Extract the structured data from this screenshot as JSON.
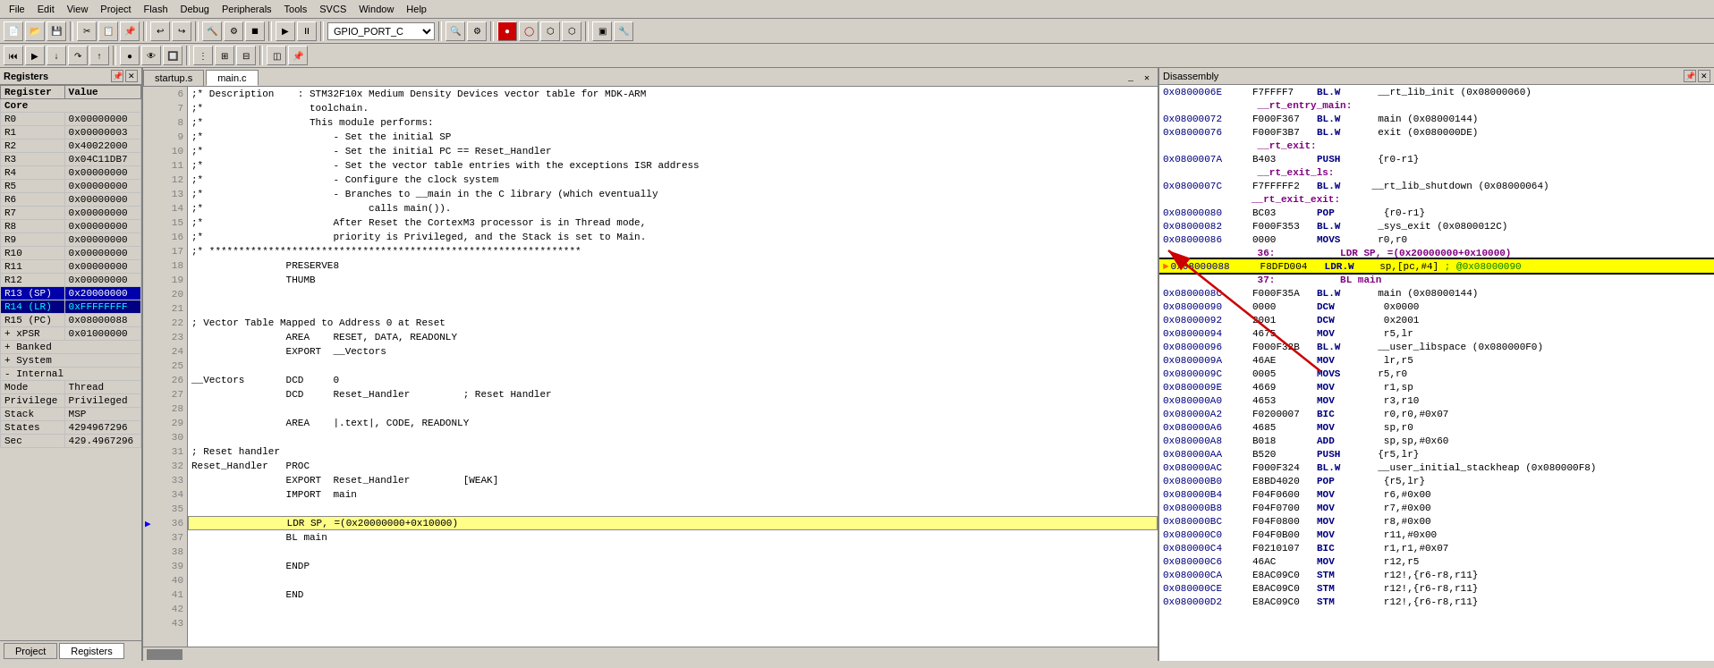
{
  "menubar": {
    "items": [
      "File",
      "Edit",
      "View",
      "Project",
      "Flash",
      "Debug",
      "Peripherals",
      "Tools",
      "SVCS",
      "Window",
      "Help"
    ]
  },
  "toolbar": {
    "dropdown_value": "GPIO_PORT_C"
  },
  "registers_panel": {
    "title": "Registers",
    "headers": [
      "Register",
      "Value"
    ],
    "core_label": "Core",
    "registers": [
      {
        "name": "R0",
        "value": "0x00000000"
      },
      {
        "name": "R1",
        "value": "0x00000003"
      },
      {
        "name": "R2",
        "value": "0x40022000"
      },
      {
        "name": "R3",
        "value": "0x04C11DB7"
      },
      {
        "name": "R4",
        "value": "0x00000000"
      },
      {
        "name": "R5",
        "value": "0x00000000"
      },
      {
        "name": "R6",
        "value": "0x00000000"
      },
      {
        "name": "R7",
        "value": "0x00000000"
      },
      {
        "name": "R8",
        "value": "0x00000000"
      },
      {
        "name": "R9",
        "value": "0x00000000"
      },
      {
        "name": "R10",
        "value": "0x00000000"
      },
      {
        "name": "R11",
        "value": "0x00000000"
      },
      {
        "name": "R12",
        "value": "0x00000000"
      },
      {
        "name": "R13 (SP)",
        "value": "0x20000000",
        "highlight": "sp"
      },
      {
        "name": "R14 (LR)",
        "value": "0xFFFFFFFF",
        "highlight": "pc"
      },
      {
        "name": "R15 (PC)",
        "value": "0x08000088"
      }
    ],
    "xpsr_label": "xPSR",
    "xpsr_value": "0x01000000",
    "banked_label": "Banked",
    "system_label": "System",
    "internal_label": "Internal",
    "internal_items": [
      {
        "label": "Mode",
        "value": "Thread"
      },
      {
        "label": "Privilege",
        "value": "Privileged"
      },
      {
        "label": "Stack",
        "value": "MSP"
      },
      {
        "label": "States",
        "value": "4294967296"
      },
      {
        "label": "Sec",
        "value": "429.4967296"
      }
    ]
  },
  "code_tabs": [
    {
      "label": "startup.s",
      "active": false
    },
    {
      "label": "main.c",
      "active": true
    }
  ],
  "code_lines": [
    {
      "num": 6,
      "text": ";* Description    : STM32F10x Medium Density Devices vector table for MDK-ARM"
    },
    {
      "num": 7,
      "text": ";*                  toolchain."
    },
    {
      "num": 8,
      "text": ";*                  This module performs:"
    },
    {
      "num": 9,
      "text": ";*                      - Set the initial SP"
    },
    {
      "num": 10,
      "text": ";*                      - Set the initial PC == Reset_Handler"
    },
    {
      "num": 11,
      "text": ";*                      - Set the vector table entries with the exceptions ISR address"
    },
    {
      "num": 12,
      "text": ";*                      - Configure the clock system"
    },
    {
      "num": 13,
      "text": ";*                      - Branches to __main in the C library (which eventually"
    },
    {
      "num": 14,
      "text": ";*                            calls main())."
    },
    {
      "num": 15,
      "text": ";*                      After Reset the CortexM3 processor is in Thread mode,"
    },
    {
      "num": 16,
      "text": ";*                      priority is Privileged, and the Stack is set to Main."
    },
    {
      "num": 17,
      "text": ";* ***************************************************************"
    },
    {
      "num": 18,
      "text": "                PRESERVE8"
    },
    {
      "num": 19,
      "text": "                THUMB"
    },
    {
      "num": 20,
      "text": ""
    },
    {
      "num": 21,
      "text": ""
    },
    {
      "num": 22,
      "text": "; Vector Table Mapped to Address 0 at Reset"
    },
    {
      "num": 23,
      "text": "                AREA    RESET, DATA, READONLY"
    },
    {
      "num": 24,
      "text": "                EXPORT  __Vectors"
    },
    {
      "num": 25,
      "text": ""
    },
    {
      "num": 26,
      "text": "__Vectors       DCD     0"
    },
    {
      "num": 27,
      "text": "                DCD     Reset_Handler         ; Reset Handler"
    },
    {
      "num": 28,
      "text": ""
    },
    {
      "num": 29,
      "text": "                AREA    |.text|, CODE, READONLY"
    },
    {
      "num": 30,
      "text": ""
    },
    {
      "num": 31,
      "text": "; Reset handler"
    },
    {
      "num": 32,
      "text": "Reset_Handler   PROC"
    },
    {
      "num": 33,
      "text": "                EXPORT  Reset_Handler         [WEAK]"
    },
    {
      "num": 34,
      "text": "                IMPORT  main"
    },
    {
      "num": 35,
      "text": ""
    },
    {
      "num": 36,
      "text": "                LDR SP, =(0x20000000+0x10000)",
      "highlight": true,
      "current": true
    },
    {
      "num": 37,
      "text": "                BL main"
    },
    {
      "num": 38,
      "text": ""
    },
    {
      "num": 39,
      "text": "                ENDP"
    },
    {
      "num": 40,
      "text": ""
    },
    {
      "num": 41,
      "text": "                END"
    },
    {
      "num": 42,
      "text": ""
    },
    {
      "num": 43,
      "text": ""
    }
  ],
  "disassembly": {
    "title": "Disassembly",
    "lines": [
      {
        "addr": "0x0800006E",
        "hex": "F7FFFF7",
        "mnem": "BL.W",
        "op": "  __rt_lib_init (0x08000060)"
      },
      {
        "label": "                __rt_entry_main:"
      },
      {
        "addr": "0x08000072",
        "hex": "F000F367",
        "mnem": "BL.W",
        "op": "  main (0x08000144)"
      },
      {
        "addr": "0x08000076",
        "hex": "F000F3B7",
        "mnem": "BL.W",
        "op": "  exit (0x080000DE)"
      },
      {
        "label": "                __rt_exit:"
      },
      {
        "addr": "0x0800007A",
        "hex": "B403",
        "mnem": "PUSH",
        "op": "  {r0-r1}"
      },
      {
        "label": "                __rt_exit_ls:"
      },
      {
        "addr": "0x0800007C",
        "hex": "F7FFFFF2",
        "mnem": "BL.W",
        "op": " __rt_lib_shutdown (0x08000064)"
      },
      {
        "label": "               __rt_exit_exit:"
      },
      {
        "addr": "0x08000080",
        "hex": "BC03",
        "mnem": "POP",
        "op": "   {r0-r1}"
      },
      {
        "addr": "0x08000082",
        "hex": "F000F353",
        "mnem": "BL.W",
        "op": "  _sys_exit (0x0800012C)"
      },
      {
        "addr": "0x08000086",
        "hex": "0000",
        "mnem": "MOVS",
        "op": "  r0,r0"
      },
      {
        "label": "                36:           LDR SP, =(0x20000000+0x10000)"
      },
      {
        "addr": "0x08000088",
        "hex": "F8DFD004",
        "mnem": "LDR.W",
        "op": " sp,[pc,#4]",
        "comment": " ; @0x08000090",
        "highlighted": true,
        "arrow_target": true
      },
      {
        "label": "                37:           BL main"
      },
      {
        "addr": "0x0800008C",
        "hex": "F000F35A",
        "mnem": "BL.W",
        "op": "  main (0x08000144)"
      },
      {
        "addr": "0x08000090",
        "hex": "0000",
        "mnem": "DCW",
        "op": "   0x0000"
      },
      {
        "addr": "0x08000092",
        "hex": "2001",
        "mnem": "DCW",
        "op": "   0x2001"
      },
      {
        "addr": "0x08000094",
        "hex": "4675",
        "mnem": "MOV",
        "op": "   r5,lr"
      },
      {
        "addr": "0x08000096",
        "hex": "F000F32B",
        "mnem": "BL.W",
        "op": "  __user_libspace (0x080000F0)"
      },
      {
        "addr": "0x0800009A",
        "hex": "46AE",
        "mnem": "MOV",
        "op": "   lr,r5"
      },
      {
        "addr": "0x0800009C",
        "hex": "0005",
        "mnem": "MOVS",
        "op": "  r5,r0"
      },
      {
        "addr": "0x0800009E",
        "hex": "4669",
        "mnem": "MOV",
        "op": "   r1,sp"
      },
      {
        "addr": "0x080000A0",
        "hex": "4653",
        "mnem": "MOV",
        "op": "   r3,r10"
      },
      {
        "addr": "0x080000A2",
        "hex": "F0200007",
        "mnem": "BIC",
        "op": "   r0,r0,#0x07"
      },
      {
        "addr": "0x080000A6",
        "hex": "4685",
        "mnem": "MOV",
        "op": "   sp,r0"
      },
      {
        "addr": "0x080000A8",
        "hex": "B018",
        "mnem": "ADD",
        "op": "   sp,sp,#0x60"
      },
      {
        "addr": "0x080000AA",
        "hex": "B520",
        "mnem": "PUSH",
        "op": "  {r5,lr}"
      },
      {
        "addr": "0x080000AC",
        "hex": "F000F324",
        "mnem": "BL.W",
        "op": "  __user_initial_stackheap (0x080000F8)"
      },
      {
        "addr": "0x080000B0",
        "hex": "E8BD4020",
        "mnem": "POP",
        "op": "   {r5,lr}"
      },
      {
        "addr": "0x080000B4",
        "hex": "F04F0600",
        "mnem": "MOV",
        "op": "   r6,#0x00"
      },
      {
        "addr": "0x080000B8",
        "hex": "F04F0700",
        "mnem": "MOV",
        "op": "   r7,#0x00"
      },
      {
        "addr": "0x080000BC",
        "hex": "F04F0800",
        "mnem": "MOV",
        "op": "   r8,#0x00"
      },
      {
        "addr": "0x080000C0",
        "hex": "F04F0B00",
        "mnem": "MOV",
        "op": "   r11,#0x00"
      },
      {
        "addr": "0x080000C4",
        "hex": "F0210107",
        "mnem": "BIC",
        "op": "   r1,r1,#0x07"
      },
      {
        "addr": "0x080000C6",
        "hex": "46AC",
        "mnem": "MOV",
        "op": "   r12,r5"
      },
      {
        "addr": "0x080000CA",
        "hex": "E8AC09C0",
        "mnem": "STM",
        "op": "   r12!,{r6-r8,r11}"
      },
      {
        "addr": "0x080000CE",
        "hex": "E8AC09C0",
        "mnem": "STM",
        "op": "   r12!,{r6-r8,r11}"
      },
      {
        "addr": "0x080000D2",
        "hex": "E8AC09C0",
        "mnem": "STM",
        "op": "   r12!,{r6-r8,r11}"
      }
    ]
  },
  "bottom_tabs": [
    "Project",
    "Registers"
  ]
}
